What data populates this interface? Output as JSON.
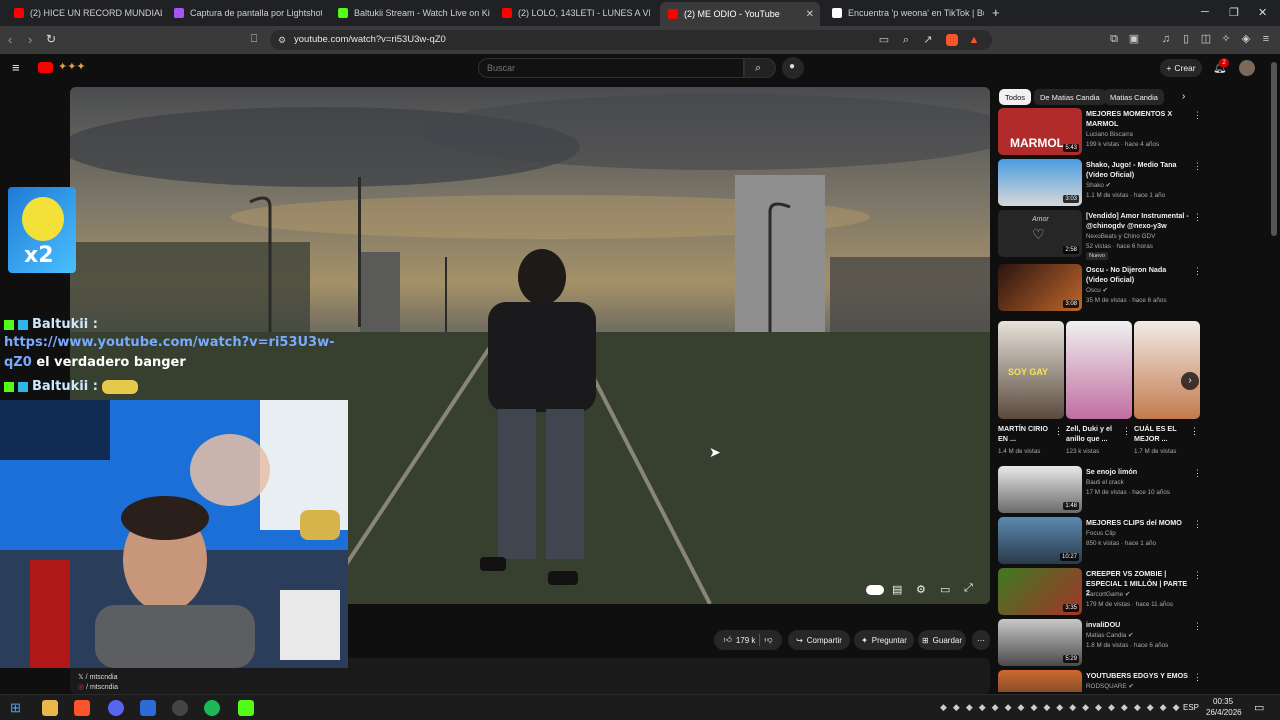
{
  "browser": {
    "tabs": [
      {
        "label": "(2) HICE UN RECORD MUNDIAL EN M",
        "icon": "youtube-icon",
        "color": "#ff0000"
      },
      {
        "label": "Captura de pantalla por Lightshot",
        "icon": "lightshot-icon",
        "color": "#a855f7"
      },
      {
        "label": "Baltukii Stream - Watch Live on Kick",
        "icon": "kick-icon",
        "color": "#53fc18"
      },
      {
        "label": "(2) LOLO, 143LETI - LUNES A VIERNES",
        "icon": "youtube-icon",
        "color": "#ff0000"
      },
      {
        "label": "(2) ME ODIO - YouTube",
        "icon": "youtube-icon",
        "color": "#ff0000",
        "active": true
      },
      {
        "label": "Encuentra 'p weona' en TikTok | Busc",
        "icon": "tiktok-icon",
        "color": "#ffffff"
      }
    ],
    "new_tab": "+",
    "url": "youtube.com/watch?v=ri53U3w-qZ0"
  },
  "youtube": {
    "search_placeholder": "Buscar",
    "create_label": "Crear",
    "notification_count": "2"
  },
  "video_actions": {
    "likes": "179 k",
    "share": "Compartir",
    "ask": "Preguntar",
    "save": "Guardar"
  },
  "overlay": {
    "multiplier": "x2",
    "chat": [
      {
        "user": "Baltukii :",
        "link": "https://www.youtube.com/watch?v=ri53U3w-",
        "link2": "qZ0",
        "message": "el verdadero banger"
      },
      {
        "user": "Baltukii :"
      }
    ],
    "socials": [
      "/ mtscndia",
      "/ mtscndia"
    ]
  },
  "sidebar": {
    "chips": [
      "Todos",
      "De Matias Candia",
      "Matias Candia"
    ],
    "recommendations": [
      {
        "title": "MEJORES MOMENTOS X MARMOL",
        "channel": "Luciano Biscarra",
        "meta": "199 k vistas · hace 4 años",
        "duration": "5:43",
        "thumb_color": "#b22b2b",
        "thumb_text": "MARMOL"
      },
      {
        "title": "Shako, Jugo! - Medio Tana (Video Oficial)",
        "channel": "Shako",
        "meta": "1.1 M de vistas · hace 1 año",
        "duration": "3:03",
        "thumb_color": "#3e85c9",
        "thumb_text": ""
      },
      {
        "title": "[Vendido] Amor Instrumental - @chinogdv @nexo-y3w",
        "channel": "NexoBeats y Chino GDV",
        "meta": "52 vistas · hace 6 horas",
        "badge": "Nuevo",
        "duration": "2:58",
        "thumb_color": "#2a2a2a",
        "thumb_text": "Amor"
      },
      {
        "title": "Oscu - No Dijeron Nada (Video Oficial)",
        "channel": "Oscu",
        "meta": "35 M de vistas · hace 6 años",
        "duration": "3:08",
        "thumb_color": "#7a3b1a",
        "thumb_text": ""
      },
      {
        "title": "Se enojo limón",
        "channel": "Bauti el crack",
        "meta": "17 M de vistas · hace 10 años",
        "duration": "1:48",
        "thumb_color": "#d9d9d9",
        "thumb_text": ""
      },
      {
        "title": "MEJORES CLIPS del MOMO",
        "channel": "Focus Clip",
        "meta": "850 k vistas · hace 1 año",
        "duration": "10:27",
        "thumb_color": "#4d7a9c",
        "thumb_text": ""
      },
      {
        "title": "CREEPER VS ZOMBIE | ESPECIAL 1 MILLÓN | PARTE 2",
        "channel": "ZarcortGame",
        "meta": "179 M de vistas · hace 11 años",
        "duration": "3:35",
        "thumb_color": "#4e8a2b",
        "thumb_text": ""
      },
      {
        "title": "invaliDOU",
        "channel": "Matias Candia",
        "meta": "1.8 M de vistas · hace 6 años",
        "duration": "5:29",
        "thumb_color": "#8a8a8a",
        "thumb_text": ""
      },
      {
        "title": "YOUTUBERS EDGYS Y EMOS",
        "channel": "RODSQUARE",
        "meta": "",
        "duration": "",
        "thumb_color": "#b3552a",
        "thumb_text": ""
      }
    ],
    "shorts": [
      {
        "title": "MARTÍN CIRIO EN ...",
        "views": "1.4 M de vistas",
        "thumb_color": "#6b5a4a",
        "thumb_text": "SOY GAY"
      },
      {
        "title": "Zell, Duki y el anillo que ...",
        "views": "123 k vistas",
        "thumb_color": "#c97fb0",
        "thumb_text": ""
      },
      {
        "title": "CUÁL ES EL MEJOR ...",
        "views": "1.7 M de vistas",
        "thumb_color": "#c9a58a",
        "thumb_text": ""
      }
    ]
  },
  "taskbar": {
    "language": "ESP",
    "time": "00:35",
    "date": "26/4/2026"
  }
}
